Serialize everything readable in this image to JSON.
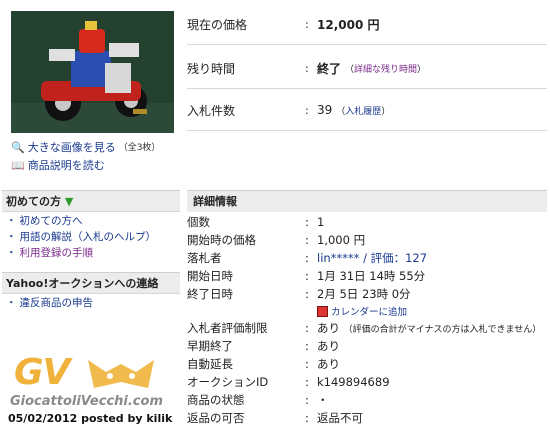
{
  "photo_alt": "item photo",
  "photo_links": {
    "large_image": "大きな画像を見る",
    "large_image_count": "（全3枚）",
    "description": "商品説明を読む"
  },
  "beginner": {
    "heading": "初めての方",
    "items": [
      "初めての方へ",
      "用語の解説（入札のヘルプ）",
      "利用登録の手順"
    ]
  },
  "contact": {
    "heading": "Yahoo!オークションへの連絡",
    "items": [
      "違反商品の申告"
    ]
  },
  "summary": {
    "price_label": "現在の価格",
    "price_value": "12,000 円",
    "time_label": "残り時間",
    "time_value": "終了",
    "time_detail_link": "詳細な残り時間",
    "bids_label": "入札件数",
    "bids_value": "39",
    "bid_history_link": "入札履歴"
  },
  "details": {
    "heading": "詳細情報",
    "rows": [
      {
        "label": "個数",
        "value": "1"
      },
      {
        "label": "開始時の価格",
        "value": "1,000 円"
      },
      {
        "label": "落札者",
        "value": "lin***** / 評価：127"
      },
      {
        "label": "開始日時",
        "value": "1月 31日 14時 55分"
      },
      {
        "label": "終了日時",
        "value": "2月 5日 23時 0分"
      }
    ],
    "calendar_link": "カレンダーに追加",
    "rows2": [
      {
        "label": "入札者評価制限",
        "value": "あり",
        "note": "（評価の合計がマイナスの方は入札できません）"
      },
      {
        "label": "早期終了",
        "value": "あり",
        "note": ""
      },
      {
        "label": "自動延長",
        "value": "あり",
        "note": ""
      },
      {
        "label": "オークションID",
        "value": "k149894689",
        "note": ""
      },
      {
        "label": "商品の状態",
        "value": "・",
        "note": ""
      },
      {
        "label": "返品の可否",
        "value": "返品不可",
        "note": ""
      }
    ]
  },
  "watermark": {
    "logo": "GV",
    "site": "GiocattoliVecchi.com",
    "posted": "05/02/2012 posted by kilik"
  },
  "colors": {
    "link": "#1a3a8f",
    "visited": "#7a2a8c",
    "watermark": "#f0b23a"
  }
}
